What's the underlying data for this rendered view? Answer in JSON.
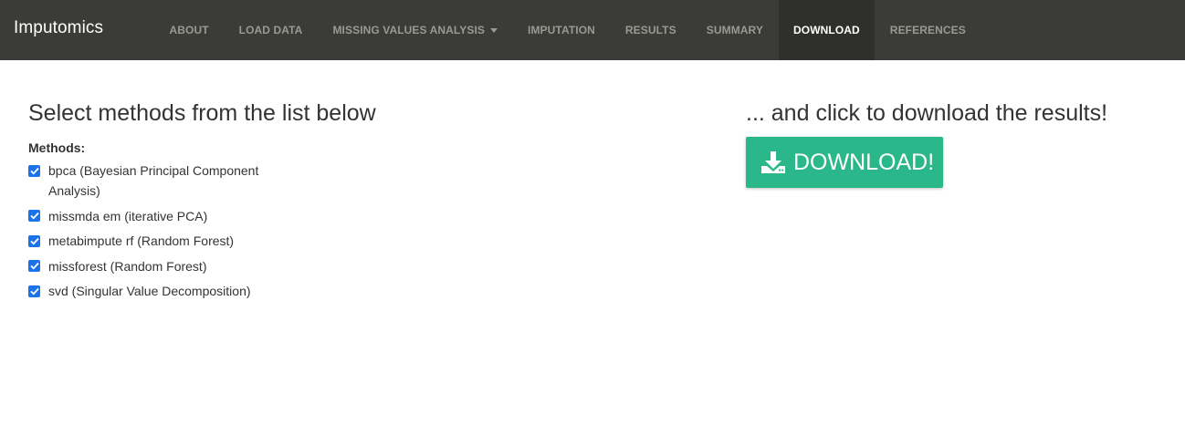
{
  "navbar": {
    "brand": "Imputomics",
    "items": [
      {
        "label": "ABOUT"
      },
      {
        "label": "LOAD DATA"
      },
      {
        "label": "MISSING VALUES ANALYSIS"
      },
      {
        "label": "IMPUTATION"
      },
      {
        "label": "RESULTS"
      },
      {
        "label": "SUMMARY"
      },
      {
        "label": "DOWNLOAD"
      },
      {
        "label": "REFERENCES"
      }
    ],
    "active": "DOWNLOAD"
  },
  "select_panel": {
    "heading": "Select methods from the list below",
    "methods_label": "Methods:",
    "methods": [
      {
        "label": "bpca (Bayesian Principal Component Analysis)",
        "checked": true
      },
      {
        "label": "missmda em (iterative PCA)",
        "checked": true
      },
      {
        "label": "metabimpute rf (Random Forest)",
        "checked": true
      },
      {
        "label": "missforest (Random Forest)",
        "checked": true
      },
      {
        "label": "svd (Singular Value Decomposition)",
        "checked": true
      }
    ]
  },
  "download_panel": {
    "heading": "... and click to download the results!",
    "button_label": "DOWNLOAD!",
    "button_icon": "download-icon",
    "button_color": "#2ab88a"
  },
  "colors": {
    "navbar_bg": "#3b3b37",
    "checkbox_accent": "#1a73e8"
  }
}
